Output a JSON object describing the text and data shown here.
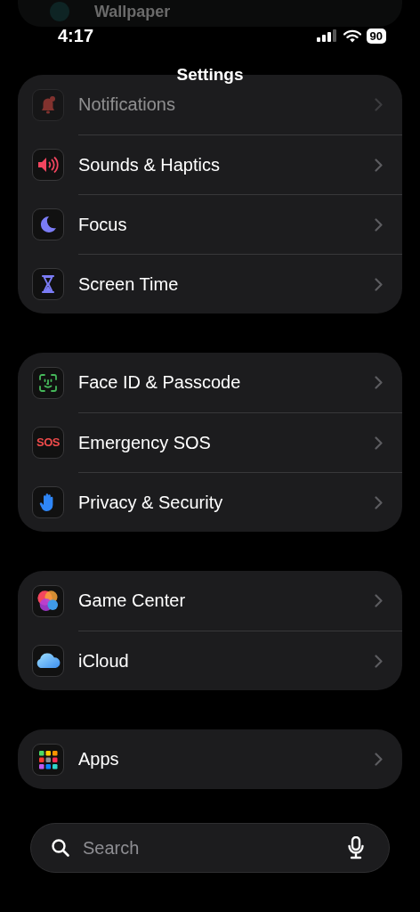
{
  "ghost_row": {
    "label": "Wallpaper"
  },
  "status_bar": {
    "time": "4:17",
    "battery": "90"
  },
  "title": "Settings",
  "groups": [
    {
      "items": [
        {
          "kind": "bell",
          "label": "Notifications",
          "dimmed": true
        },
        {
          "kind": "speaker",
          "label": "Sounds & Haptics",
          "dimmed": false
        },
        {
          "kind": "moon",
          "label": "Focus",
          "dimmed": false
        },
        {
          "kind": "hourglass",
          "label": "Screen Time",
          "dimmed": false
        }
      ]
    },
    {
      "items": [
        {
          "kind": "faceid",
          "label": "Face ID & Passcode",
          "dimmed": false
        },
        {
          "kind": "sos",
          "icon_text": "SOS",
          "label": "Emergency SOS",
          "dimmed": false
        },
        {
          "kind": "hand",
          "label": "Privacy & Security",
          "dimmed": false
        }
      ]
    },
    {
      "items": [
        {
          "kind": "gamecenter",
          "label": "Game Center",
          "dimmed": false
        },
        {
          "kind": "cloud",
          "label": "iCloud",
          "dimmed": false
        }
      ]
    },
    {
      "items": [
        {
          "kind": "grid",
          "label": "Apps",
          "dimmed": false
        }
      ]
    }
  ],
  "search": {
    "placeholder": "Search"
  }
}
